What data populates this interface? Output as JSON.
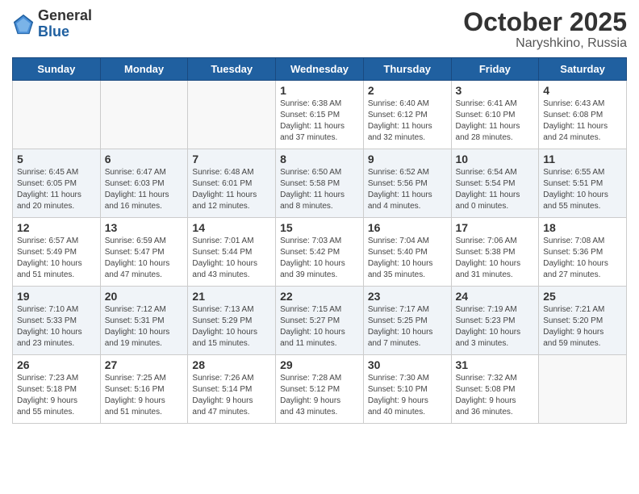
{
  "header": {
    "logo_general": "General",
    "logo_blue": "Blue",
    "month": "October 2025",
    "location": "Naryshkino, Russia"
  },
  "days_of_week": [
    "Sunday",
    "Monday",
    "Tuesday",
    "Wednesday",
    "Thursday",
    "Friday",
    "Saturday"
  ],
  "weeks": [
    [
      {
        "day": "",
        "info": ""
      },
      {
        "day": "",
        "info": ""
      },
      {
        "day": "",
        "info": ""
      },
      {
        "day": "1",
        "info": "Sunrise: 6:38 AM\nSunset: 6:15 PM\nDaylight: 11 hours\nand 37 minutes."
      },
      {
        "day": "2",
        "info": "Sunrise: 6:40 AM\nSunset: 6:12 PM\nDaylight: 11 hours\nand 32 minutes."
      },
      {
        "day": "3",
        "info": "Sunrise: 6:41 AM\nSunset: 6:10 PM\nDaylight: 11 hours\nand 28 minutes."
      },
      {
        "day": "4",
        "info": "Sunrise: 6:43 AM\nSunset: 6:08 PM\nDaylight: 11 hours\nand 24 minutes."
      }
    ],
    [
      {
        "day": "5",
        "info": "Sunrise: 6:45 AM\nSunset: 6:05 PM\nDaylight: 11 hours\nand 20 minutes."
      },
      {
        "day": "6",
        "info": "Sunrise: 6:47 AM\nSunset: 6:03 PM\nDaylight: 11 hours\nand 16 minutes."
      },
      {
        "day": "7",
        "info": "Sunrise: 6:48 AM\nSunset: 6:01 PM\nDaylight: 11 hours\nand 12 minutes."
      },
      {
        "day": "8",
        "info": "Sunrise: 6:50 AM\nSunset: 5:58 PM\nDaylight: 11 hours\nand 8 minutes."
      },
      {
        "day": "9",
        "info": "Sunrise: 6:52 AM\nSunset: 5:56 PM\nDaylight: 11 hours\nand 4 minutes."
      },
      {
        "day": "10",
        "info": "Sunrise: 6:54 AM\nSunset: 5:54 PM\nDaylight: 11 hours\nand 0 minutes."
      },
      {
        "day": "11",
        "info": "Sunrise: 6:55 AM\nSunset: 5:51 PM\nDaylight: 10 hours\nand 55 minutes."
      }
    ],
    [
      {
        "day": "12",
        "info": "Sunrise: 6:57 AM\nSunset: 5:49 PM\nDaylight: 10 hours\nand 51 minutes."
      },
      {
        "day": "13",
        "info": "Sunrise: 6:59 AM\nSunset: 5:47 PM\nDaylight: 10 hours\nand 47 minutes."
      },
      {
        "day": "14",
        "info": "Sunrise: 7:01 AM\nSunset: 5:44 PM\nDaylight: 10 hours\nand 43 minutes."
      },
      {
        "day": "15",
        "info": "Sunrise: 7:03 AM\nSunset: 5:42 PM\nDaylight: 10 hours\nand 39 minutes."
      },
      {
        "day": "16",
        "info": "Sunrise: 7:04 AM\nSunset: 5:40 PM\nDaylight: 10 hours\nand 35 minutes."
      },
      {
        "day": "17",
        "info": "Sunrise: 7:06 AM\nSunset: 5:38 PM\nDaylight: 10 hours\nand 31 minutes."
      },
      {
        "day": "18",
        "info": "Sunrise: 7:08 AM\nSunset: 5:36 PM\nDaylight: 10 hours\nand 27 minutes."
      }
    ],
    [
      {
        "day": "19",
        "info": "Sunrise: 7:10 AM\nSunset: 5:33 PM\nDaylight: 10 hours\nand 23 minutes."
      },
      {
        "day": "20",
        "info": "Sunrise: 7:12 AM\nSunset: 5:31 PM\nDaylight: 10 hours\nand 19 minutes."
      },
      {
        "day": "21",
        "info": "Sunrise: 7:13 AM\nSunset: 5:29 PM\nDaylight: 10 hours\nand 15 minutes."
      },
      {
        "day": "22",
        "info": "Sunrise: 7:15 AM\nSunset: 5:27 PM\nDaylight: 10 hours\nand 11 minutes."
      },
      {
        "day": "23",
        "info": "Sunrise: 7:17 AM\nSunset: 5:25 PM\nDaylight: 10 hours\nand 7 minutes."
      },
      {
        "day": "24",
        "info": "Sunrise: 7:19 AM\nSunset: 5:23 PM\nDaylight: 10 hours\nand 3 minutes."
      },
      {
        "day": "25",
        "info": "Sunrise: 7:21 AM\nSunset: 5:20 PM\nDaylight: 9 hours\nand 59 minutes."
      }
    ],
    [
      {
        "day": "26",
        "info": "Sunrise: 7:23 AM\nSunset: 5:18 PM\nDaylight: 9 hours\nand 55 minutes."
      },
      {
        "day": "27",
        "info": "Sunrise: 7:25 AM\nSunset: 5:16 PM\nDaylight: 9 hours\nand 51 minutes."
      },
      {
        "day": "28",
        "info": "Sunrise: 7:26 AM\nSunset: 5:14 PM\nDaylight: 9 hours\nand 47 minutes."
      },
      {
        "day": "29",
        "info": "Sunrise: 7:28 AM\nSunset: 5:12 PM\nDaylight: 9 hours\nand 43 minutes."
      },
      {
        "day": "30",
        "info": "Sunrise: 7:30 AM\nSunset: 5:10 PM\nDaylight: 9 hours\nand 40 minutes."
      },
      {
        "day": "31",
        "info": "Sunrise: 7:32 AM\nSunset: 5:08 PM\nDaylight: 9 hours\nand 36 minutes."
      },
      {
        "day": "",
        "info": ""
      }
    ]
  ]
}
